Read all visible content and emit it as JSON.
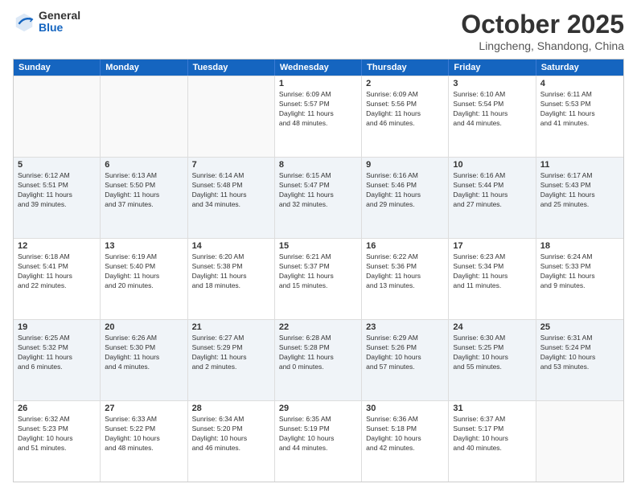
{
  "logo": {
    "general": "General",
    "blue": "Blue"
  },
  "title": "October 2025",
  "location": "Lingcheng, Shandong, China",
  "days": [
    "Sunday",
    "Monday",
    "Tuesday",
    "Wednesday",
    "Thursday",
    "Friday",
    "Saturday"
  ],
  "weeks": [
    [
      {
        "day": "",
        "lines": []
      },
      {
        "day": "",
        "lines": []
      },
      {
        "day": "",
        "lines": []
      },
      {
        "day": "1",
        "lines": [
          "Sunrise: 6:09 AM",
          "Sunset: 5:57 PM",
          "Daylight: 11 hours",
          "and 48 minutes."
        ]
      },
      {
        "day": "2",
        "lines": [
          "Sunrise: 6:09 AM",
          "Sunset: 5:56 PM",
          "Daylight: 11 hours",
          "and 46 minutes."
        ]
      },
      {
        "day": "3",
        "lines": [
          "Sunrise: 6:10 AM",
          "Sunset: 5:54 PM",
          "Daylight: 11 hours",
          "and 44 minutes."
        ]
      },
      {
        "day": "4",
        "lines": [
          "Sunrise: 6:11 AM",
          "Sunset: 5:53 PM",
          "Daylight: 11 hours",
          "and 41 minutes."
        ]
      }
    ],
    [
      {
        "day": "5",
        "lines": [
          "Sunrise: 6:12 AM",
          "Sunset: 5:51 PM",
          "Daylight: 11 hours",
          "and 39 minutes."
        ]
      },
      {
        "day": "6",
        "lines": [
          "Sunrise: 6:13 AM",
          "Sunset: 5:50 PM",
          "Daylight: 11 hours",
          "and 37 minutes."
        ]
      },
      {
        "day": "7",
        "lines": [
          "Sunrise: 6:14 AM",
          "Sunset: 5:48 PM",
          "Daylight: 11 hours",
          "and 34 minutes."
        ]
      },
      {
        "day": "8",
        "lines": [
          "Sunrise: 6:15 AM",
          "Sunset: 5:47 PM",
          "Daylight: 11 hours",
          "and 32 minutes."
        ]
      },
      {
        "day": "9",
        "lines": [
          "Sunrise: 6:16 AM",
          "Sunset: 5:46 PM",
          "Daylight: 11 hours",
          "and 29 minutes."
        ]
      },
      {
        "day": "10",
        "lines": [
          "Sunrise: 6:16 AM",
          "Sunset: 5:44 PM",
          "Daylight: 11 hours",
          "and 27 minutes."
        ]
      },
      {
        "day": "11",
        "lines": [
          "Sunrise: 6:17 AM",
          "Sunset: 5:43 PM",
          "Daylight: 11 hours",
          "and 25 minutes."
        ]
      }
    ],
    [
      {
        "day": "12",
        "lines": [
          "Sunrise: 6:18 AM",
          "Sunset: 5:41 PM",
          "Daylight: 11 hours",
          "and 22 minutes."
        ]
      },
      {
        "day": "13",
        "lines": [
          "Sunrise: 6:19 AM",
          "Sunset: 5:40 PM",
          "Daylight: 11 hours",
          "and 20 minutes."
        ]
      },
      {
        "day": "14",
        "lines": [
          "Sunrise: 6:20 AM",
          "Sunset: 5:38 PM",
          "Daylight: 11 hours",
          "and 18 minutes."
        ]
      },
      {
        "day": "15",
        "lines": [
          "Sunrise: 6:21 AM",
          "Sunset: 5:37 PM",
          "Daylight: 11 hours",
          "and 15 minutes."
        ]
      },
      {
        "day": "16",
        "lines": [
          "Sunrise: 6:22 AM",
          "Sunset: 5:36 PM",
          "Daylight: 11 hours",
          "and 13 minutes."
        ]
      },
      {
        "day": "17",
        "lines": [
          "Sunrise: 6:23 AM",
          "Sunset: 5:34 PM",
          "Daylight: 11 hours",
          "and 11 minutes."
        ]
      },
      {
        "day": "18",
        "lines": [
          "Sunrise: 6:24 AM",
          "Sunset: 5:33 PM",
          "Daylight: 11 hours",
          "and 9 minutes."
        ]
      }
    ],
    [
      {
        "day": "19",
        "lines": [
          "Sunrise: 6:25 AM",
          "Sunset: 5:32 PM",
          "Daylight: 11 hours",
          "and 6 minutes."
        ]
      },
      {
        "day": "20",
        "lines": [
          "Sunrise: 6:26 AM",
          "Sunset: 5:30 PM",
          "Daylight: 11 hours",
          "and 4 minutes."
        ]
      },
      {
        "day": "21",
        "lines": [
          "Sunrise: 6:27 AM",
          "Sunset: 5:29 PM",
          "Daylight: 11 hours",
          "and 2 minutes."
        ]
      },
      {
        "day": "22",
        "lines": [
          "Sunrise: 6:28 AM",
          "Sunset: 5:28 PM",
          "Daylight: 11 hours",
          "and 0 minutes."
        ]
      },
      {
        "day": "23",
        "lines": [
          "Sunrise: 6:29 AM",
          "Sunset: 5:26 PM",
          "Daylight: 10 hours",
          "and 57 minutes."
        ]
      },
      {
        "day": "24",
        "lines": [
          "Sunrise: 6:30 AM",
          "Sunset: 5:25 PM",
          "Daylight: 10 hours",
          "and 55 minutes."
        ]
      },
      {
        "day": "25",
        "lines": [
          "Sunrise: 6:31 AM",
          "Sunset: 5:24 PM",
          "Daylight: 10 hours",
          "and 53 minutes."
        ]
      }
    ],
    [
      {
        "day": "26",
        "lines": [
          "Sunrise: 6:32 AM",
          "Sunset: 5:23 PM",
          "Daylight: 10 hours",
          "and 51 minutes."
        ]
      },
      {
        "day": "27",
        "lines": [
          "Sunrise: 6:33 AM",
          "Sunset: 5:22 PM",
          "Daylight: 10 hours",
          "and 48 minutes."
        ]
      },
      {
        "day": "28",
        "lines": [
          "Sunrise: 6:34 AM",
          "Sunset: 5:20 PM",
          "Daylight: 10 hours",
          "and 46 minutes."
        ]
      },
      {
        "day": "29",
        "lines": [
          "Sunrise: 6:35 AM",
          "Sunset: 5:19 PM",
          "Daylight: 10 hours",
          "and 44 minutes."
        ]
      },
      {
        "day": "30",
        "lines": [
          "Sunrise: 6:36 AM",
          "Sunset: 5:18 PM",
          "Daylight: 10 hours",
          "and 42 minutes."
        ]
      },
      {
        "day": "31",
        "lines": [
          "Sunrise: 6:37 AM",
          "Sunset: 5:17 PM",
          "Daylight: 10 hours",
          "and 40 minutes."
        ]
      },
      {
        "day": "",
        "lines": []
      }
    ]
  ]
}
